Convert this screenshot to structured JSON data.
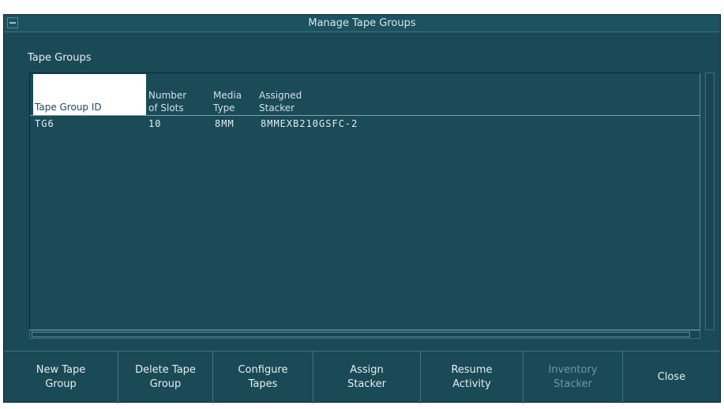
{
  "window": {
    "title": "Manage Tape Groups"
  },
  "section_label": "Tape Groups",
  "table": {
    "columns": [
      {
        "label": "Tape Group ID"
      },
      {
        "label": "Number\nof Slots"
      },
      {
        "label": "Media\nType"
      },
      {
        "label": "Assigned\nStacker"
      }
    ],
    "rows": [
      {
        "id": "TG6",
        "slots": "10",
        "media": "8MM",
        "stacker": "8MMEXB210GSFC-2"
      }
    ]
  },
  "buttons": {
    "new_tape_group": "New Tape\nGroup",
    "delete_tape_group": "Delete Tape\nGroup",
    "configure_tapes": "Configure\nTapes",
    "assign_stacker": "Assign\nStacker",
    "resume_activity": "Resume\nActivity",
    "inventory_stacker": "Inventory\nStacker",
    "close": "Close"
  },
  "colors": {
    "background": "#1a4a56",
    "header_highlight": "#ffffff",
    "text": "#e4eef0",
    "disabled_text": "#6d9aa4"
  }
}
